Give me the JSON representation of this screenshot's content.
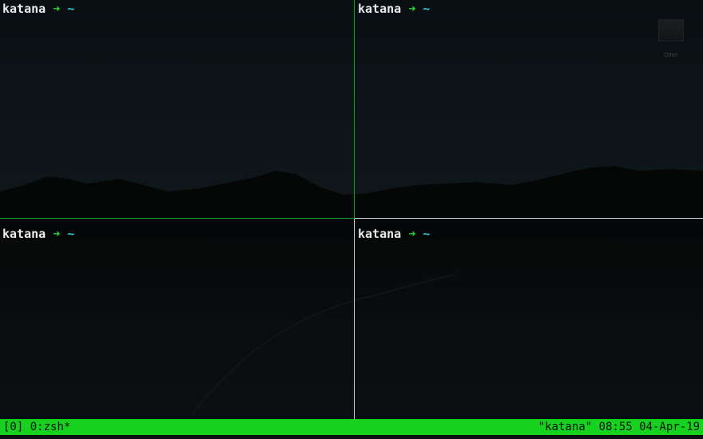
{
  "terminal": {
    "app": "tmux",
    "panes": [
      {
        "id": "top-left",
        "host": "katana",
        "arrow": "➜",
        "cwd": "~",
        "active": true
      },
      {
        "id": "top-right",
        "host": "katana",
        "arrow": "➜",
        "cwd": "~",
        "active": false
      },
      {
        "id": "bottom-left",
        "host": "katana",
        "arrow": "➜",
        "cwd": "~",
        "active": false
      },
      {
        "id": "bottom-right",
        "host": "katana",
        "arrow": "➜",
        "cwd": "~",
        "active": false
      }
    ],
    "colors": {
      "active_border": "#18a02a",
      "inactive_border": "#cfd3d6",
      "status_bg": "#17d11f",
      "prompt_arrow": "#22d33a",
      "prompt_cwd": "#2fc6d6"
    }
  },
  "status_bar": {
    "session": "[0]",
    "window": "0:zsh*",
    "hostname": "\"katana\"",
    "time": "08:55",
    "date": "04-Apr-19"
  },
  "desktop": {
    "icon": {
      "name": "folder-icon",
      "label": "Other"
    }
  }
}
